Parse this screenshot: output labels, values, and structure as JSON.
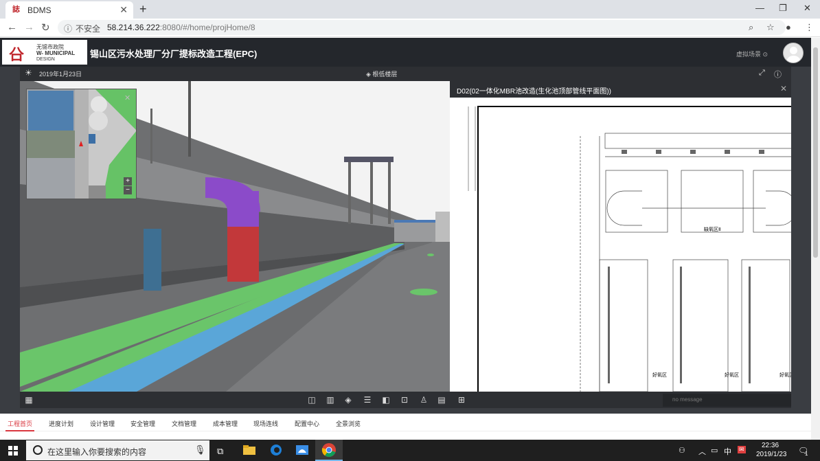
{
  "browser": {
    "tab_title": "BDMS",
    "security_label": "不安全",
    "url_host": "58.214.36.222",
    "url_rest": ":8080/#/home/projHome/8"
  },
  "app": {
    "logo_line1": "无锡市政院",
    "logo_line2": "W- MUNICIPAL",
    "logo_line3": "DESIGN",
    "project_title": "锡山区污水处理厂分厂提标改造工程(EPC)",
    "virtual_scene": "虚拟场景 ⊙"
  },
  "viewer": {
    "date": "2019年1月23日",
    "floor_label": "根低楼层",
    "drawing_title": "D02(02一体化MBR池改造(生化池顶部管线平面图))",
    "message": "no message",
    "drawing_labels": {
      "anoxic_zone": "缺氧区Ⅱ",
      "aerobic_zone": "好氧区"
    }
  },
  "bottom_nav": [
    "工程首页",
    "进度计划",
    "设计管理",
    "安全管理",
    "文档管理",
    "成本管理",
    "现场连线",
    "配置中心",
    "全景浏览"
  ],
  "taskbar": {
    "search_placeholder": "在这里输入你要搜索的内容",
    "time": "22:36",
    "date": "2019/1/23",
    "ime": "中",
    "notifications": "1"
  },
  "colors": {
    "accent_red": "#d9363e",
    "header_bg": "#24272c",
    "viewer_bg": "#2d2f33"
  }
}
